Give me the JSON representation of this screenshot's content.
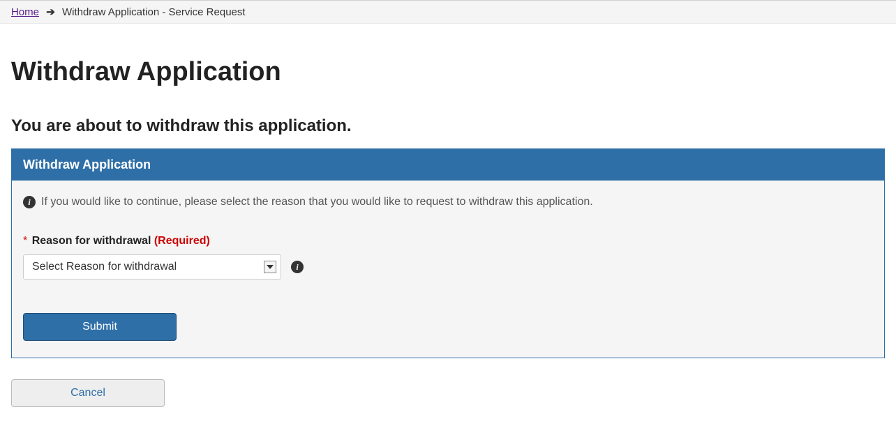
{
  "breadcrumb": {
    "home_label": "Home",
    "current_label": "Withdraw Application - Service Request"
  },
  "page": {
    "title": "Withdraw Application",
    "subtitle": "You are about to withdraw this application."
  },
  "panel": {
    "header": "Withdraw Application",
    "info_text": "If you would like to continue, please select the reason that you would like to request to withdraw this application."
  },
  "form": {
    "reason": {
      "asterisk": "*",
      "label": "Reason for withdrawal",
      "required_text": "(Required)",
      "selected": "Select Reason for withdrawal"
    },
    "submit_label": "Submit",
    "cancel_label": "Cancel"
  }
}
